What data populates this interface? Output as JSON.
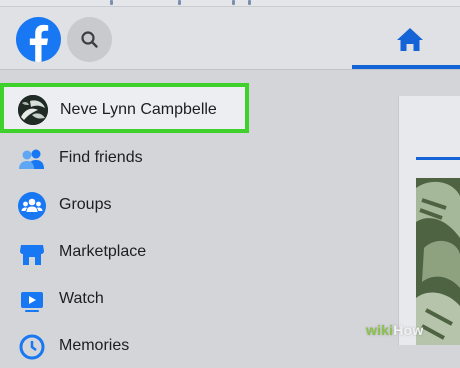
{
  "header": {
    "logo_icon": "facebook-logo-icon",
    "search_icon": "search-icon",
    "home_icon": "home-icon",
    "accent_color": "#1877f2"
  },
  "sidebar": {
    "profile": {
      "label": "Neve Lynn Campbelle",
      "highlight_color": "#3ed12c"
    },
    "items": [
      {
        "label": "Find friends",
        "icon": "friends-icon"
      },
      {
        "label": "Groups",
        "icon": "groups-icon"
      },
      {
        "label": "Marketplace",
        "icon": "marketplace-icon"
      },
      {
        "label": "Watch",
        "icon": "watch-icon"
      },
      {
        "label": "Memories",
        "icon": "memories-icon"
      }
    ]
  },
  "watermark": {
    "prefix": "wiki",
    "suffix": "How"
  }
}
